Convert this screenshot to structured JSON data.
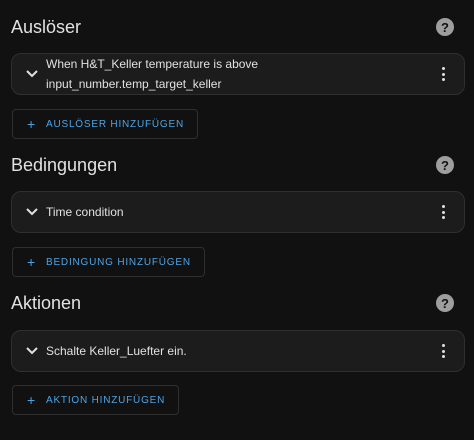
{
  "sections": [
    {
      "title": "Auslöser",
      "card_line1": "When H&T_Keller temperature is above",
      "card_line2": "input_number.temp_target_keller",
      "add_label": "AUSLÖSER HINZUFÜGEN"
    },
    {
      "title": "Bedingungen",
      "card_line1": "Time condition",
      "add_label": "BEDINGUNG HINZUFÜGEN"
    },
    {
      "title": "Aktionen",
      "card_line1": "Schalte Keller_Luefter ein.",
      "add_label": "AKTION HINZUFÜGEN"
    }
  ],
  "icons": {
    "help": "help-circle-icon",
    "expand": "chevron-down-icon",
    "menu": "dots-vertical-icon",
    "add": "plus-icon"
  },
  "colors": {
    "background": "#111111",
    "card": "#1c1c1c",
    "border": "#2f2f2f",
    "text": "#e1e1e1",
    "accent": "#4ea3e5",
    "help_icon": "#9e9e9e"
  }
}
